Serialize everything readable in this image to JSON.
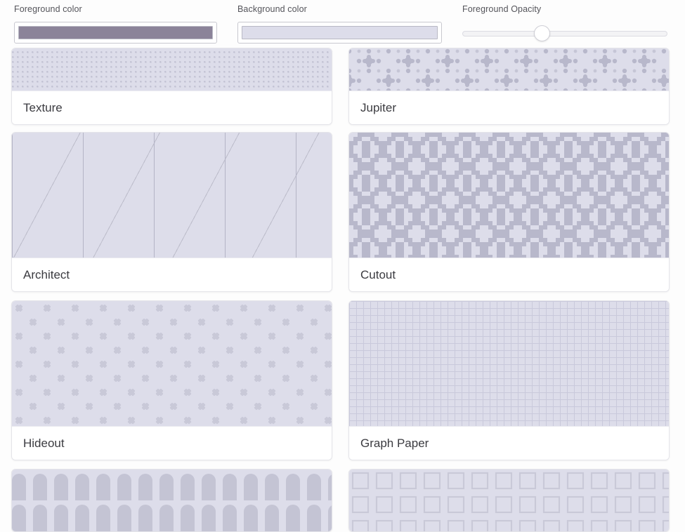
{
  "toolbar": {
    "foreground_color_label": "Foreground color",
    "background_color_label": "Background color",
    "foreground_opacity_label": "Foreground Opacity",
    "foreground_color_value": "#8b8399",
    "background_color_value": "#ddddea",
    "opacity_value": 38
  },
  "grid": {
    "cards": [
      {
        "name": "Texture",
        "pattern": "texture"
      },
      {
        "name": "Jupiter",
        "pattern": "jupiter"
      },
      {
        "name": "Architect",
        "pattern": "architect"
      },
      {
        "name": "Cutout",
        "pattern": "cutout"
      },
      {
        "name": "Hideout",
        "pattern": "hideout"
      },
      {
        "name": "Graph Paper",
        "pattern": "graph"
      }
    ],
    "partial_row": [
      {
        "pattern": "bumps"
      },
      {
        "pattern": "boxes"
      }
    ]
  }
}
